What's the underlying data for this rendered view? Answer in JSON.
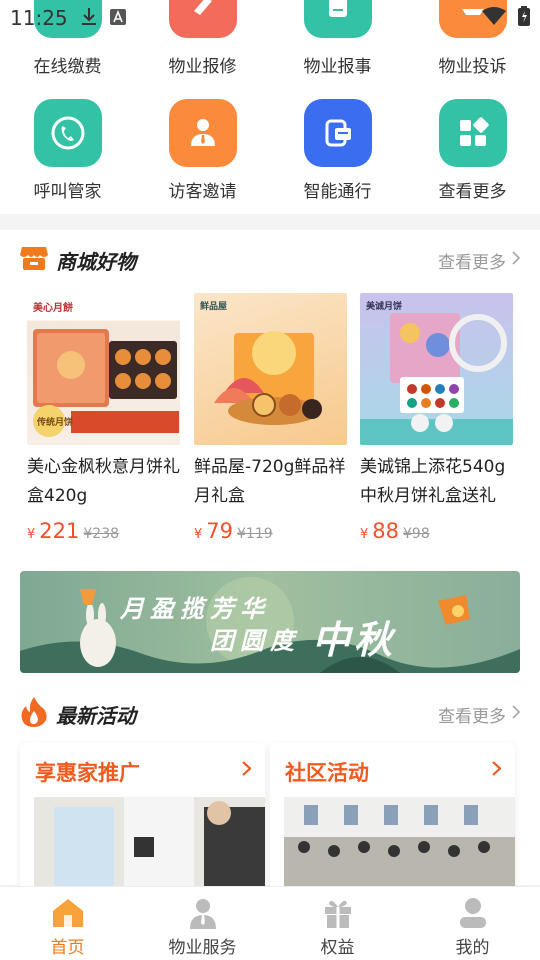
{
  "status_bar": {
    "time": "11:25"
  },
  "services": [
    {
      "label": "在线缴费",
      "icon": "payment-icon",
      "color": "#33c2a6"
    },
    {
      "label": "物业报修",
      "icon": "repair-icon",
      "color": "#f26b5b"
    },
    {
      "label": "物业报事",
      "icon": "report-icon",
      "color": "#33c2a6"
    },
    {
      "label": "物业投诉",
      "icon": "complaint-icon",
      "color": "#fb8a3a"
    },
    {
      "label": "呼叫管家",
      "icon": "phone-icon",
      "color": "#33c2a6"
    },
    {
      "label": "访客邀请",
      "icon": "visitor-icon",
      "color": "#fb8a3a"
    },
    {
      "label": "智能通行",
      "icon": "access-card-icon",
      "color": "#3a6df0"
    },
    {
      "label": "查看更多",
      "icon": "grid-more-icon",
      "color": "#33c2a6"
    }
  ],
  "shop": {
    "title": "商城好物",
    "more": "查看更多",
    "products": [
      {
        "name": "美心金枫秋意月饼礼盒420g",
        "currency": "¥",
        "price": "221",
        "old_price": "¥238",
        "box_brand": "美心月餅",
        "box_tag": "传统月饼"
      },
      {
        "name": "鲜品屋-720g鲜品祥月礼盒",
        "currency": "¥",
        "price": "79",
        "old_price": "¥119",
        "box_brand": "鲜品屋"
      },
      {
        "name": "美诚锦上添花540g中秋月饼礼盒送礼",
        "currency": "¥",
        "price": "88",
        "old_price": "¥98",
        "box_brand": "美诚月饼"
      }
    ]
  },
  "banner": {
    "line1": "月盈揽芳华",
    "line2": "团圆度",
    "line3": "中秋"
  },
  "activities": {
    "title": "最新活动",
    "more": "查看更多",
    "cards": [
      {
        "title": "享惠家推广"
      },
      {
        "title": "社区活动"
      }
    ]
  },
  "tabbar": [
    {
      "label": "首页",
      "icon": "home-icon",
      "active": true
    },
    {
      "label": "物业服务",
      "icon": "service-icon",
      "active": false
    },
    {
      "label": "权益",
      "icon": "gift-icon",
      "active": false
    },
    {
      "label": "我的",
      "icon": "profile-icon",
      "active": false
    }
  ],
  "colors": {
    "accent": "#f07a1c",
    "price": "#f0502a"
  }
}
